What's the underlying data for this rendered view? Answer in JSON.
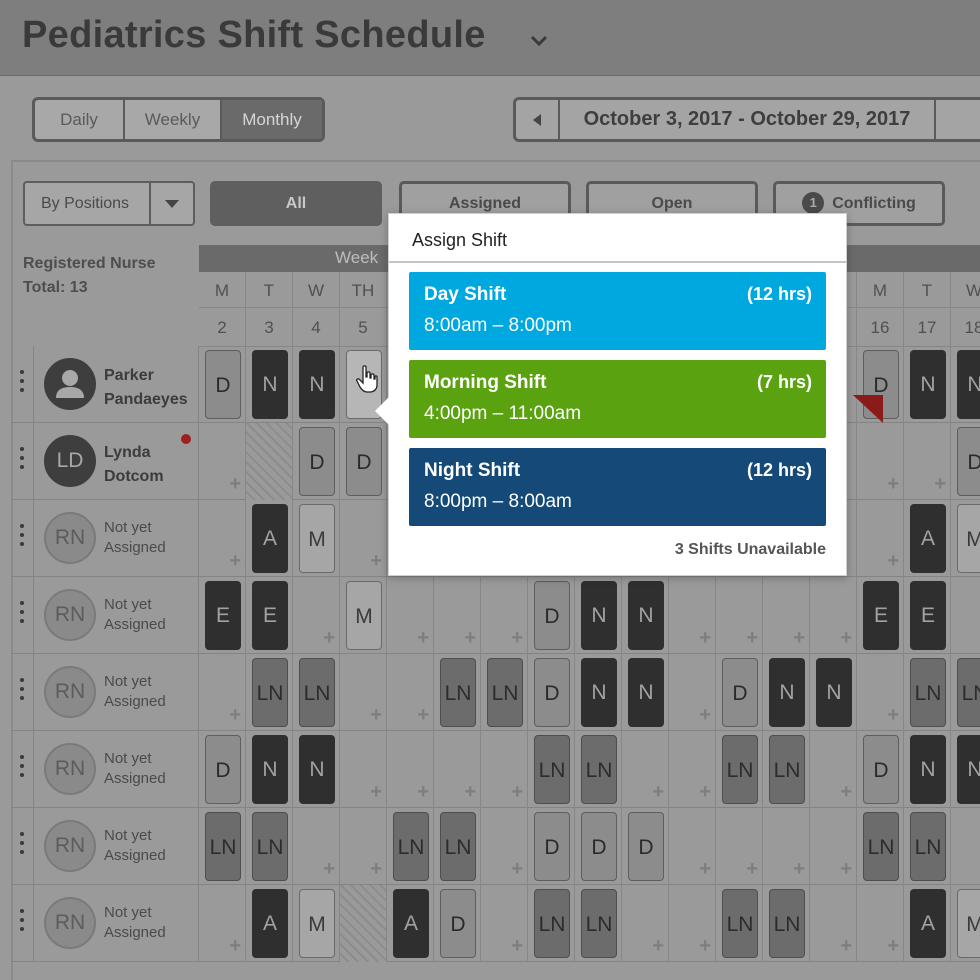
{
  "header": {
    "title": "Pediatrics Shift Schedule"
  },
  "view_tabs": [
    "Daily",
    "Weekly",
    "Monthly"
  ],
  "active_view": "Monthly",
  "date_range": "October 3, 2017 - October 29, 2017",
  "filters": {
    "position_select": "By Positions",
    "all": "All",
    "assigned": "Assigned",
    "open": "Open",
    "conflicting_count": "1",
    "conflicting": "Conflicting"
  },
  "roster": {
    "title": "Registered Nurse",
    "total": "Total: 13"
  },
  "week_label": "Week",
  "days": [
    {
      "d": "M",
      "n": "2"
    },
    {
      "d": "T",
      "n": "3"
    },
    {
      "d": "W",
      "n": "4"
    },
    {
      "d": "TH",
      "n": "5"
    },
    {
      "d": "",
      "n": ""
    },
    {
      "d": "",
      "n": ""
    },
    {
      "d": "",
      "n": ""
    },
    {
      "d": "",
      "n": ""
    },
    {
      "d": "",
      "n": ""
    },
    {
      "d": "",
      "n": ""
    },
    {
      "d": "",
      "n": ""
    },
    {
      "d": "",
      "n": ""
    },
    {
      "d": "",
      "n": ""
    },
    {
      "d": "",
      "n": ""
    },
    {
      "d": "M",
      "n": "16"
    },
    {
      "d": "T",
      "n": "17"
    },
    {
      "d": "W",
      "n": "18"
    }
  ],
  "staff": [
    {
      "initials": "",
      "name": [
        "Parker",
        "Pandaeyes"
      ],
      "assigned": true,
      "avatar": "person-icon"
    },
    {
      "initials": "LD",
      "name": [
        "Lynda",
        "Dotcom"
      ],
      "assigned": true,
      "alert": true
    },
    {
      "initials": "RN",
      "name": [
        "Not yet",
        "Assigned"
      ],
      "assigned": false
    },
    {
      "initials": "RN",
      "name": [
        "Not yet",
        "Assigned"
      ],
      "assigned": false
    },
    {
      "initials": "RN",
      "name": [
        "Not yet",
        "Assigned"
      ],
      "assigned": false
    },
    {
      "initials": "RN",
      "name": [
        "Not yet",
        "Assigned"
      ],
      "assigned": false
    },
    {
      "initials": "RN",
      "name": [
        "Not yet",
        "Assigned"
      ],
      "assigned": false
    },
    {
      "initials": "RN",
      "name": [
        "Not yet",
        "Assigned"
      ],
      "assigned": false
    }
  ],
  "cells": [
    [
      "D:light",
      "N:dark",
      "N:dark",
      "cursor",
      "",
      "",
      "",
      "",
      "",
      "",
      "",
      "",
      "",
      "",
      "D:light",
      "N:dark",
      "N:dark"
    ],
    [
      "+",
      "hatch",
      "D:light",
      "D:light",
      "",
      "",
      "",
      "",
      "",
      "",
      "",
      "",
      "",
      "",
      "+",
      "+",
      "D:light"
    ],
    [
      "+",
      "A:dark",
      "M:pale",
      "+",
      "",
      "",
      "",
      "",
      "",
      "",
      "",
      "",
      "",
      "",
      "+",
      "A:dark",
      "M:pale"
    ],
    [
      "E:dark",
      "E:dark",
      "+",
      "M:pale",
      "+",
      "+",
      "+",
      "D:light",
      "N:dark",
      "N:dark",
      "+",
      "+",
      "+",
      "+",
      "E:dark",
      "E:dark",
      "+"
    ],
    [
      "+",
      "LN:mid",
      "LN:mid",
      "+",
      "+",
      "LN:mid",
      "LN:mid",
      "D:light",
      "N:dark",
      "N:dark",
      "+",
      "D:light",
      "N:dark",
      "N:dark",
      "+",
      "LN:mid",
      "LN:mid"
    ],
    [
      "D:light",
      "N:dark",
      "N:dark",
      "+",
      "+",
      "+",
      "+",
      "LN:mid",
      "LN:mid",
      "+",
      "+",
      "LN:mid",
      "LN:mid",
      "+",
      "D:light",
      "N:dark",
      "N:dark"
    ],
    [
      "LN:mid",
      "LN:mid",
      "+",
      "+",
      "LN:mid",
      "LN:mid",
      "+",
      "D:light",
      "D:light",
      "D:light",
      "+",
      "+",
      "+",
      "+",
      "LN:mid",
      "LN:mid",
      "+"
    ],
    [
      "+",
      "A:dark",
      "M:pale",
      "hatch",
      "A:dark",
      "D:light",
      "+",
      "LN:mid",
      "LN:mid",
      "+",
      "+",
      "LN:mid",
      "LN:mid",
      "+",
      "+",
      "A:dark",
      "M:pale"
    ]
  ],
  "popup": {
    "title": "Assign Shift",
    "shifts": [
      {
        "name": "Day Shift",
        "hours": "(12 hrs)",
        "time": "8:00am – 8:00pm",
        "color": "#00a8e0"
      },
      {
        "name": "Morning Shift",
        "hours": "(7 hrs)",
        "time": "4:00pm – 11:00am",
        "color": "#5aa20f"
      },
      {
        "name": "Night Shift",
        "hours": "(12 hrs)",
        "time": "8:00pm – 8:00am",
        "color": "#154a78"
      }
    ],
    "unavailable": "3 Shifts Unavailable"
  }
}
